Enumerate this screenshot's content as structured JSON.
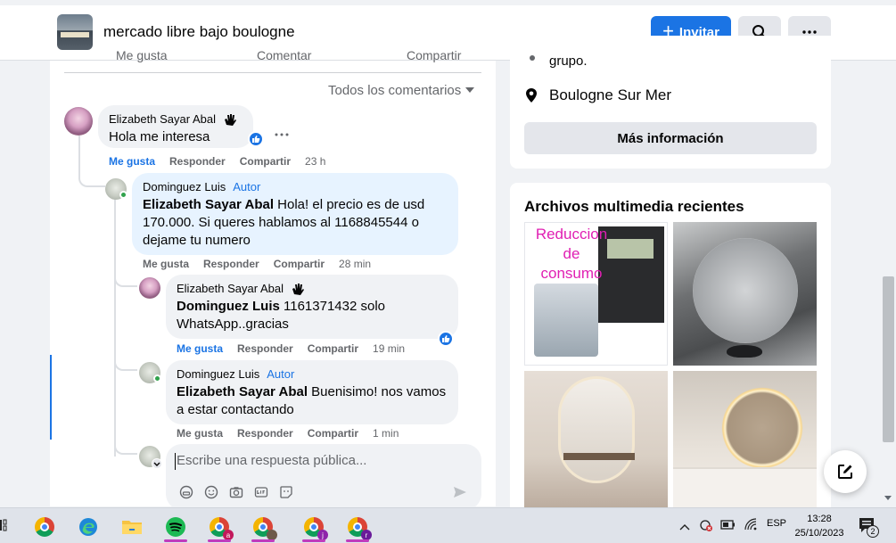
{
  "header": {
    "group_name": "mercado libre bajo boulogne",
    "invite_label": "Invitar"
  },
  "feed": {
    "actions_partial": [
      "Me gusta",
      "Comentar",
      "Compartir"
    ],
    "sort_label": "Todos los comentarios",
    "comments": [
      {
        "author": "Elizabeth Sayar Abal",
        "text": "Hola me interesa",
        "actions": [
          "Me gusta",
          "Responder",
          "Compartir"
        ],
        "time": "23 h"
      },
      {
        "author": "Dominguez Luis",
        "tag": "Autor",
        "mention": "Elizabeth Sayar Abal",
        "text": " Hola! el precio es de usd 170.000. Si queres hablamos al 1168845544 o dejame tu numero",
        "actions": [
          "Me gusta",
          "Responder",
          "Compartir"
        ],
        "time": "28 min"
      },
      {
        "author": "Elizabeth Sayar Abal",
        "mention": "Dominguez Luis",
        "text": " 1161371432 solo WhatsApp..gracias",
        "actions": [
          "Me gusta",
          "Responder",
          "Compartir"
        ],
        "time": "19 min"
      },
      {
        "author": "Dominguez Luis",
        "tag": "Autor",
        "mention": "Elizabeth Sayar Abal",
        "text": " Buenisimo! nos vamos a estar contactando",
        "actions": [
          "Me gusta",
          "Responder",
          "Compartir"
        ],
        "time": "1 min"
      }
    ],
    "reply_placeholder": "Escribe una respuesta pública..."
  },
  "about": {
    "fragment": "grupo.",
    "location": "Boulogne Sur Mer",
    "more_info_label": "Más información"
  },
  "media": {
    "title": "Archivos multimedia recientes",
    "tile1_text": "Reduccion de consumo"
  },
  "taskbar": {
    "time": "13:28",
    "date": "25/10/2023",
    "lang": "ESP",
    "notification_count": "2",
    "badges": [
      "a",
      "j",
      "r"
    ]
  },
  "colors": {
    "accent": "#1b74e4",
    "background": "#f0f2f5",
    "bubble": "#f0f2f5",
    "bubble_author": "#e7f3ff",
    "online": "#31a24c"
  }
}
